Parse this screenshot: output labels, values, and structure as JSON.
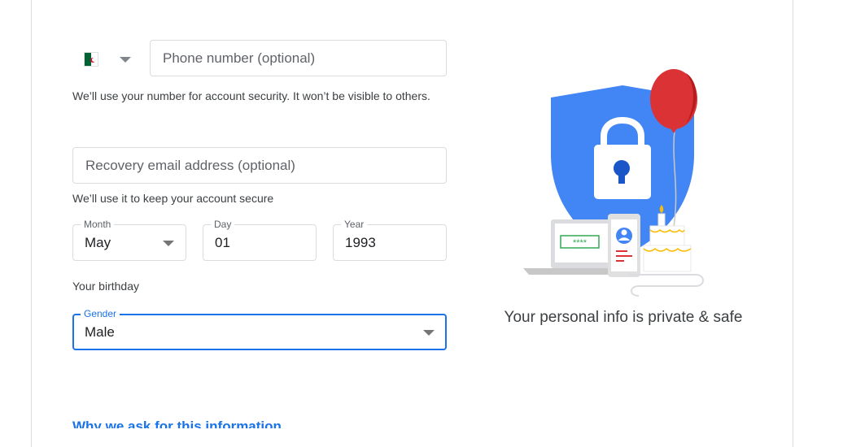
{
  "phone": {
    "country_flag": "algeria-flag",
    "placeholder": "Phone number (optional)",
    "helper": "We’ll use your number for account security. It won’t be visible to others."
  },
  "recovery": {
    "placeholder": "Recovery email address (optional)",
    "helper": "We’ll use it to keep your account secure"
  },
  "birthday": {
    "month_label": "Month",
    "month_value": "May",
    "day_label": "Day",
    "day_value": "01",
    "year_label": "Year",
    "year_value": "1993",
    "helper": "Your birthday"
  },
  "gender": {
    "label": "Gender",
    "value": "Male"
  },
  "link": {
    "why_text": "Why we ask for this information"
  },
  "illustration": {
    "caption": "Your personal info is private & safe",
    "password_mask": "****"
  },
  "colors": {
    "accent": "#1a73e8",
    "shield": "#4285f4",
    "balloon": "#db3236",
    "flag_green": "#006233",
    "flag_red": "#d21034"
  }
}
